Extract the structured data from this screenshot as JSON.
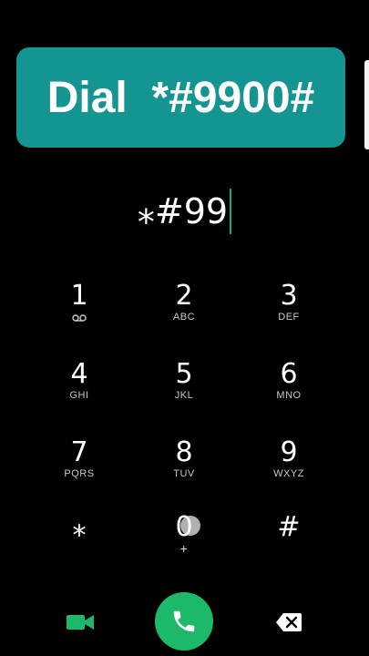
{
  "banner": {
    "text": "Dial  *#9900#"
  },
  "dialer": {
    "entry": "⁎#99"
  },
  "keypad": [
    {
      "digit": "1",
      "letters": ""
    },
    {
      "digit": "2",
      "letters": "ABC"
    },
    {
      "digit": "3",
      "letters": "DEF"
    },
    {
      "digit": "4",
      "letters": "GHI"
    },
    {
      "digit": "5",
      "letters": "JKL"
    },
    {
      "digit": "6",
      "letters": "MNO"
    },
    {
      "digit": "7",
      "letters": "PQRS"
    },
    {
      "digit": "8",
      "letters": "TUV"
    },
    {
      "digit": "9",
      "letters": "WXYZ"
    },
    {
      "digit": "⁎",
      "letters": ""
    },
    {
      "digit": "0",
      "letters": "+"
    },
    {
      "digit": "#",
      "letters": ""
    }
  ],
  "icons": {
    "voicemail": "voicemail-icon",
    "video_call": "video-call-icon",
    "call": "phone-icon",
    "backspace": "backspace-icon"
  },
  "colors": {
    "banner_bg": "#159592",
    "call_button": "#1db96a",
    "video_icon": "#1db96a",
    "caret": "#1fa27a",
    "background": "#000000"
  }
}
